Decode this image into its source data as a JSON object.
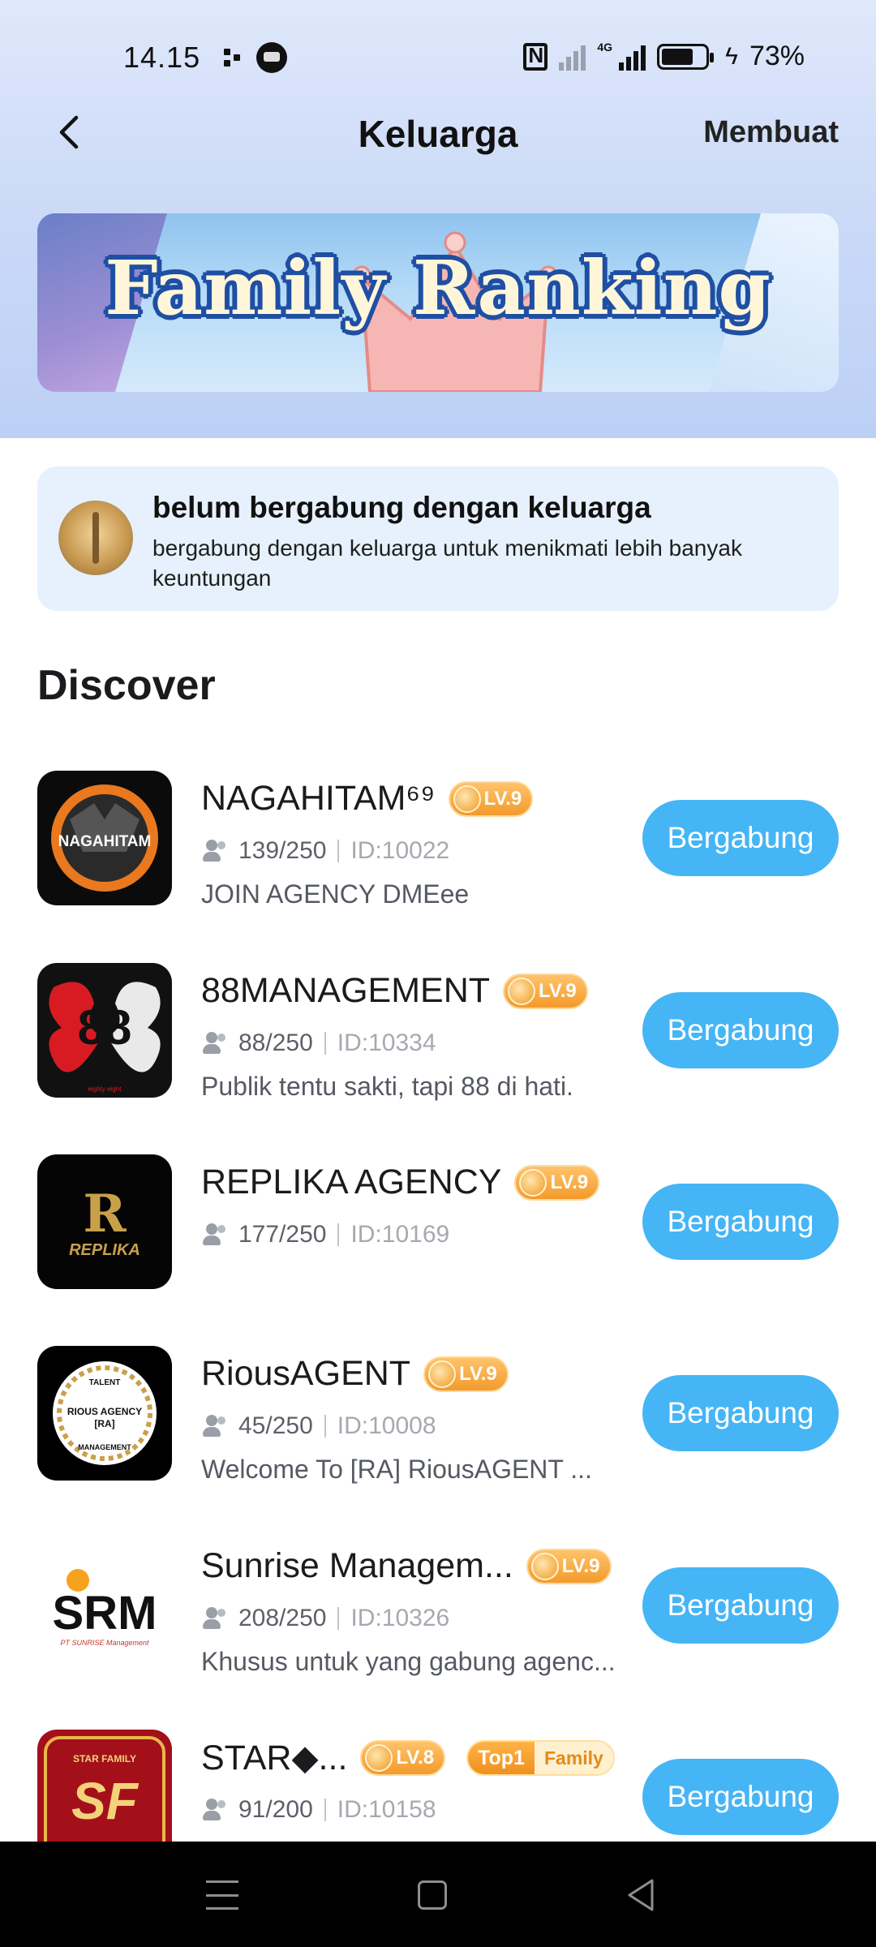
{
  "status_bar": {
    "time": "14.15",
    "network": "4G",
    "battery": "73%",
    "battery_level": 0.73
  },
  "header": {
    "title": "Keluarga",
    "action": "Membuat"
  },
  "banner": {
    "text": "Family Ranking"
  },
  "notice": {
    "title": "belum bergabung dengan keluarga",
    "subtitle": "bergabung dengan keluarga untuk menikmati lebih banyak keuntungan"
  },
  "discover": {
    "title": "Discover",
    "join_label": "Bergabung",
    "families": [
      {
        "name": "NAGAHITAM⁶⁹",
        "level": "LV.9",
        "members": "139/250",
        "id": "ID:10022",
        "description": "JOIN AGENCY DMEee",
        "avatar_text": "NAGAHITAM",
        "avatar_color": "#0b0b0b"
      },
      {
        "name": "88MANAGEMENT",
        "level": "LV.9",
        "members": "88/250",
        "id": "ID:10334",
        "description": "Publik tentu sakti, tapi 88 di hati.",
        "avatar_text": "88",
        "avatar_sub": "eighty eight",
        "avatar_color": "#111111"
      },
      {
        "name": "REPLIKA AGENCY",
        "level": "LV.9",
        "members": "177/250",
        "id": "ID:10169",
        "description": "",
        "avatar_text": "REPLIKA",
        "avatar_mark": "R",
        "avatar_color": "#050505"
      },
      {
        "name": "RiousAGENT",
        "level": "LV.9",
        "members": "45/250",
        "id": "ID:10008",
        "description": "Welcome To [RA] RiousAGENT ...",
        "avatar_text": "RIOUS AGENCY",
        "avatar_top": "TALENT",
        "avatar_bottom": "MANAGEMENT",
        "avatar_mark": "[RA]",
        "avatar_color": "#000000"
      },
      {
        "name": "Sunrise Managem...",
        "level": "LV.9",
        "members": "208/250",
        "id": "ID:10326",
        "description": "Khusus untuk yang gabung agenc...",
        "avatar_text": "SRM",
        "avatar_sub": "PT SUNRISE Management",
        "avatar_color": "#ffffff"
      },
      {
        "name": "STAR◆...",
        "level": "LV.8",
        "members": "91/200",
        "id": "ID:10158",
        "description": "",
        "top_badge": {
          "rank": "Top1",
          "label": "Family"
        },
        "avatar_text": "SF",
        "avatar_top": "STAR FAMILY",
        "avatar_color": "#a3101a"
      }
    ]
  }
}
